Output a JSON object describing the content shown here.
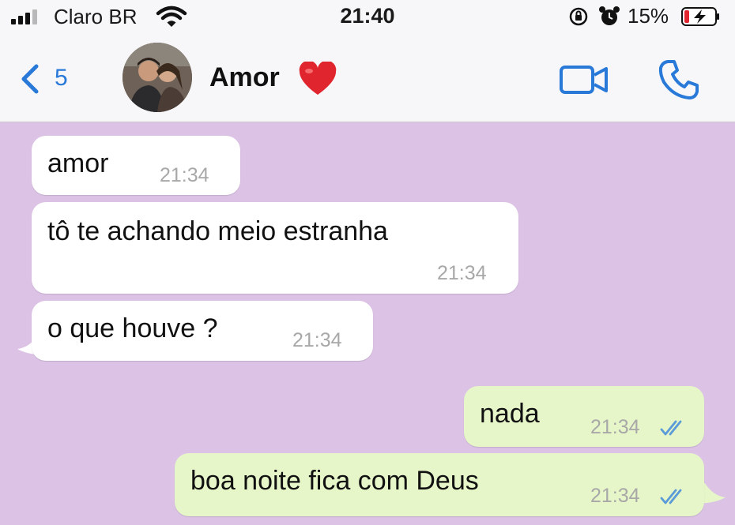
{
  "status_bar": {
    "carrier": "Claro BR",
    "time": "21:40",
    "battery_percent": "15%"
  },
  "header": {
    "unread_count": "5",
    "contact_name": "Amor"
  },
  "messages": [
    {
      "direction": "incoming",
      "text": "amor",
      "time": "21:34"
    },
    {
      "direction": "incoming",
      "text": "tô te achando meio estranha",
      "time": "21:34"
    },
    {
      "direction": "incoming",
      "text": "o que houve ?",
      "time": "21:34"
    },
    {
      "direction": "outgoing",
      "text": "nada",
      "time": "21:34",
      "status": "read"
    },
    {
      "direction": "outgoing",
      "text": "boa noite fica com Deus",
      "time": "21:34",
      "status": "read"
    }
  ],
  "colors": {
    "chat_background": "#dcc3e6",
    "incoming_bubble": "#ffffff",
    "outgoing_bubble": "#e6f6c9",
    "accent": "#2879d8",
    "read_ticks": "#5b9bd8",
    "heart": "#e0252e"
  },
  "icons": [
    "signal-icon",
    "wifi-icon",
    "orientation-lock-icon",
    "alarm-icon",
    "battery-charging-icon",
    "back-chevron-icon",
    "heart-emoji",
    "video-call-icon",
    "phone-call-icon",
    "double-check-icon"
  ]
}
